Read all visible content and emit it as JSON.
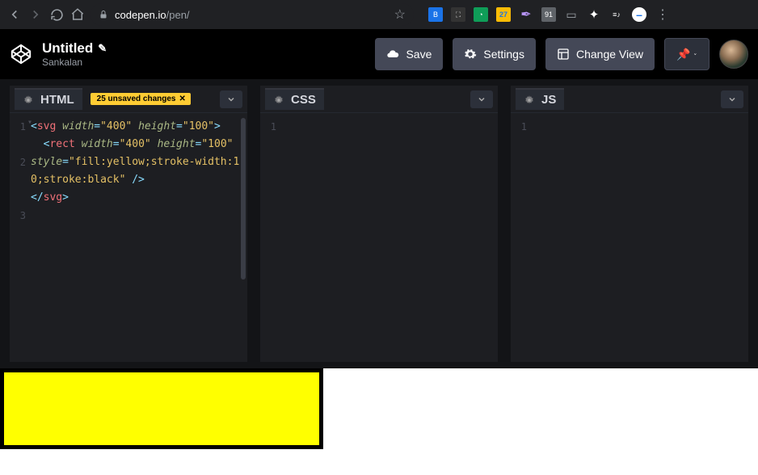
{
  "browser": {
    "url_host": "codepen.io",
    "url_path": "/pen/",
    "ext_badge": "27"
  },
  "header": {
    "title": "Untitled",
    "subtitle": "Sankalan",
    "save_label": "Save",
    "settings_label": "Settings",
    "change_view_label": "Change View"
  },
  "panels": {
    "html": {
      "title": "HTML",
      "badge": "25 unsaved changes",
      "lines": [
        "1",
        "2",
        "3"
      ],
      "code": {
        "l1_tag": "svg",
        "l1_a1": "width",
        "l1_v1": "\"400\"",
        "l1_a2": "height",
        "l1_v2": "\"100\"",
        "l2_tag": "rect",
        "l2_a1": "width",
        "l2_v1": "\"400\"",
        "l2_a2": "height",
        "l2_v2": "\"100\"",
        "l2_a3": "style",
        "l2_v3": "\"fill:yellow;stroke-width:10;stroke:black\"",
        "l3_tag": "svg"
      }
    },
    "css": {
      "title": "CSS",
      "lines": [
        "1"
      ]
    },
    "js": {
      "title": "JS",
      "lines": [
        "1"
      ]
    }
  },
  "preview_svg": {
    "width": "400",
    "height": "100",
    "rect_style": "fill:yellow;stroke-width:10;stroke:black"
  }
}
